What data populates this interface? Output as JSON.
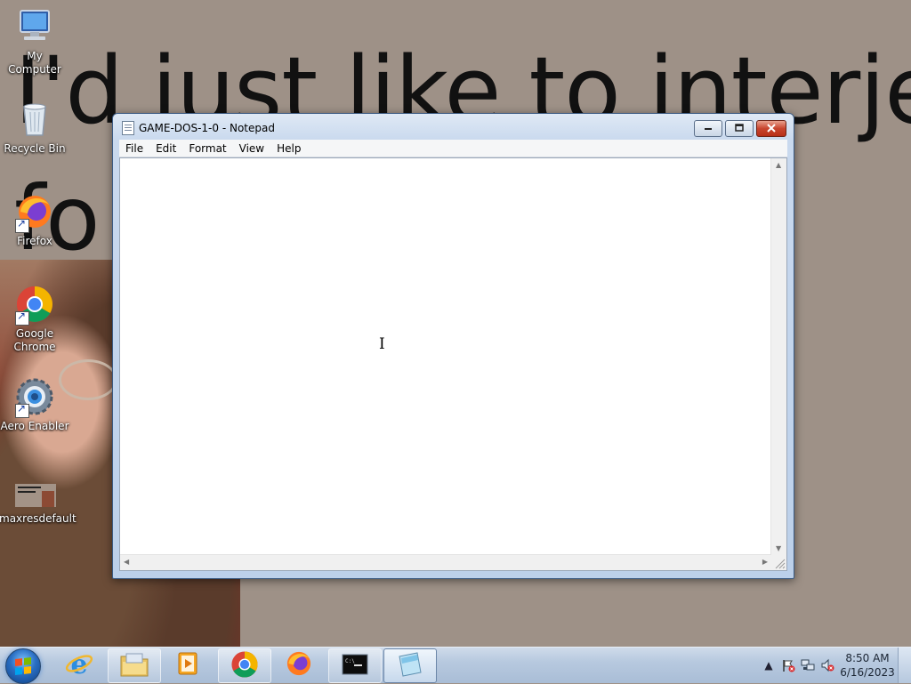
{
  "wallpaper": {
    "line1": "I'd just like to interje",
    "line2": "fo"
  },
  "desktop": {
    "icons": [
      {
        "label": "My Computer",
        "icon": "computer-icon"
      },
      {
        "label": "Recycle Bin",
        "icon": "recycle-bin-icon"
      },
      {
        "label": "Firefox",
        "icon": "firefox-icon"
      },
      {
        "label": "Google Chrome",
        "icon": "chrome-icon"
      },
      {
        "label": "Aero Enabler",
        "icon": "aero-enabler-icon"
      },
      {
        "label": "maxresdefault",
        "icon": "image-file-icon"
      }
    ]
  },
  "notepad": {
    "title": "GAME-DOS-1-0 - Notepad",
    "menu": [
      "File",
      "Edit",
      "Format",
      "View",
      "Help"
    ],
    "content": "",
    "caption_buttons": {
      "minimize": "minimize-icon",
      "maximize": "maximize-icon",
      "close": "close-icon"
    }
  },
  "taskbar": {
    "items": [
      {
        "name": "internet-explorer",
        "icon": "ie-icon",
        "state": "pinned"
      },
      {
        "name": "windows-explorer",
        "icon": "folder-icon",
        "state": "pinned"
      },
      {
        "name": "media-player",
        "icon": "media-player-icon",
        "state": "pinned"
      },
      {
        "name": "chrome",
        "icon": "chrome-icon",
        "state": "pinned"
      },
      {
        "name": "firefox",
        "icon": "firefox-icon",
        "state": "pinned"
      },
      {
        "name": "command-prompt",
        "icon": "cmd-icon",
        "state": "running"
      },
      {
        "name": "notepad",
        "icon": "notepad-icon",
        "state": "active"
      }
    ],
    "tray": {
      "time": "8:50 AM",
      "date": "6/16/2023",
      "icons": [
        "show-hidden-icons-arrow",
        "action-center-flag-icon",
        "network-icon",
        "volume-muted-icon"
      ]
    }
  },
  "colors": {
    "desktop_bg": "#9e9187",
    "window_frame": "#bcd0ea",
    "close_button": "#c8452f"
  }
}
